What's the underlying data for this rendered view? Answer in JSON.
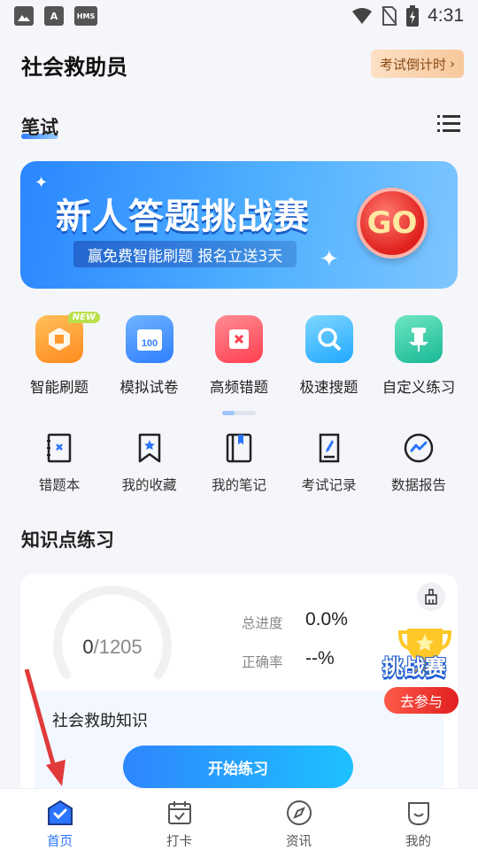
{
  "status_bar": {
    "time": "4:31",
    "icons": [
      "image-icon",
      "a-icon",
      "hms-icon"
    ],
    "icon_labels": {
      "a": "A",
      "hms": "HMS"
    }
  },
  "header": {
    "title": "社会救助员",
    "countdown_label": "考试倒计时"
  },
  "section": {
    "title": "笔试"
  },
  "banner": {
    "title": "新人答题挑战赛",
    "subtitle": "赢免费智能刷题  报名立送3天",
    "go_label": "GO"
  },
  "features": [
    {
      "label": "智能刷题",
      "icon": "smart-practice-icon",
      "badge": "NEW",
      "color": "#ff9a2e"
    },
    {
      "label": "模拟试卷",
      "icon": "mock-exam-icon",
      "color": "#3d8bff"
    },
    {
      "label": "高频错题",
      "icon": "frequent-mistakes-icon",
      "color": "#ff4d5a"
    },
    {
      "label": "极速搜题",
      "icon": "quick-search-icon",
      "color": "#2fb6ff"
    },
    {
      "label": "自定义练习",
      "icon": "custom-practice-icon",
      "color": "#22c3a0"
    }
  ],
  "tools": [
    {
      "label": "错题本",
      "icon": "mistake-book-icon"
    },
    {
      "label": "我的收藏",
      "icon": "favorites-icon"
    },
    {
      "label": "我的笔记",
      "icon": "notes-icon"
    },
    {
      "label": "考试记录",
      "icon": "exam-record-icon"
    },
    {
      "label": "数据报告",
      "icon": "data-report-icon"
    }
  ],
  "knowledge": {
    "title": "知识点练习",
    "done": "0",
    "total": "/1205",
    "progress_label": "总进度",
    "progress_value": "0.0%",
    "accuracy_label": "正确率",
    "accuracy_value": "--%",
    "subject": "社会救助知识",
    "start_label": "开始练习"
  },
  "challenge": {
    "title": "挑战赛",
    "join_label": "去参与"
  },
  "nav": [
    {
      "label": "首页",
      "icon": "home-icon",
      "active": true
    },
    {
      "label": "打卡",
      "icon": "checkin-calendar-icon"
    },
    {
      "label": "资讯",
      "icon": "compass-icon"
    },
    {
      "label": "我的",
      "icon": "profile-icon"
    }
  ],
  "colors": {
    "accent": "#2a74ff",
    "banner": "#3a9bff",
    "go": "#e0201c",
    "annotation_arrow": "#e03a3a"
  }
}
